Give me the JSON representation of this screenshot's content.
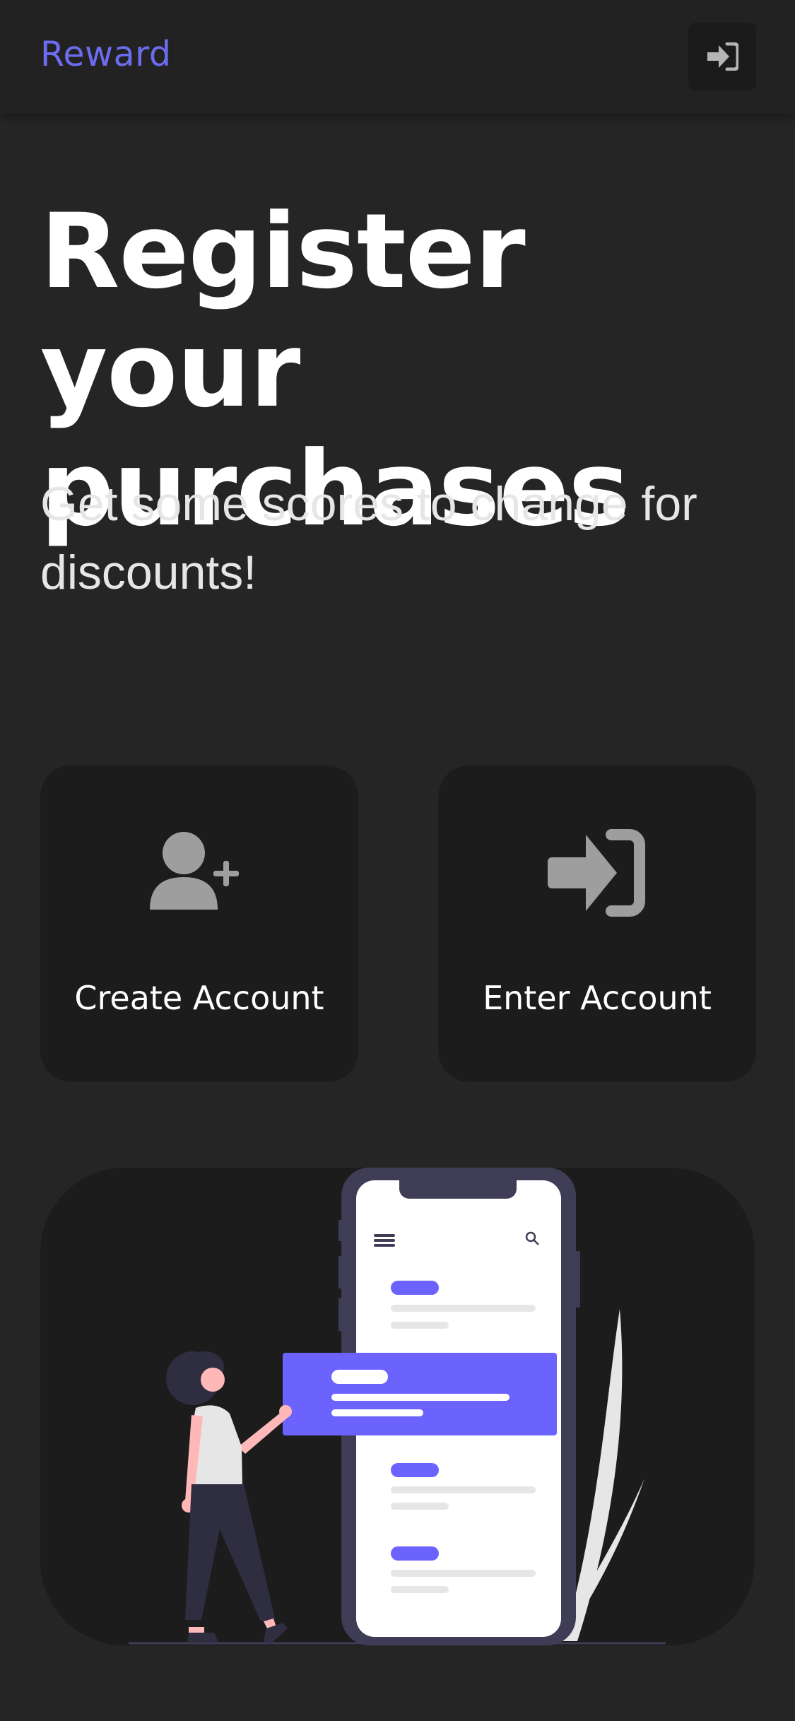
{
  "header": {
    "brand": "Reward",
    "login_icon": "sign-in-icon"
  },
  "hero": {
    "title": "Register your purchases",
    "subtitle": "Get some scores to change for discounts!"
  },
  "actions": [
    {
      "label": "Create Account",
      "icon": "user-plus-icon"
    },
    {
      "label": "Enter Account",
      "icon": "sign-in-icon"
    }
  ],
  "illustration": {
    "icon": "phone-app-illustration"
  },
  "colors": {
    "accent": "#6c63ff",
    "brand": "#6c6cf0",
    "background": "#252526",
    "card": "#1c1c1d",
    "icon": "#9e9e9e"
  }
}
